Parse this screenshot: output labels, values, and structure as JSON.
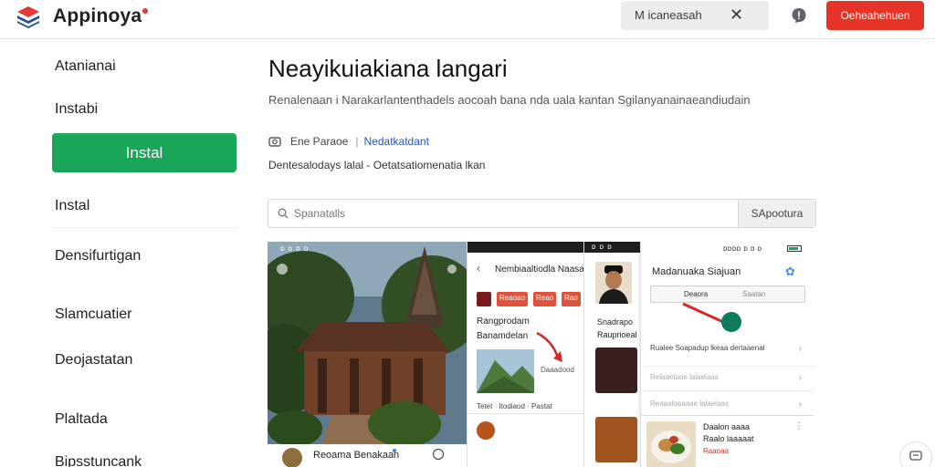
{
  "header": {
    "brand": "Appinoya",
    "search_chip": "M icaneasah",
    "close_glyph": "✕",
    "action_button": "Oeheahehuen",
    "colors": {
      "accent": "#e53427",
      "install": "#1aa659"
    }
  },
  "sidebar": {
    "items": [
      {
        "label": "Atanianai"
      },
      {
        "label": "Instabi"
      },
      {
        "label": "Instal"
      },
      {
        "label": "Instal"
      },
      {
        "label": "Densifurtigan"
      },
      {
        "label": "Slamcuatier"
      },
      {
        "label": "Deojastatan"
      },
      {
        "label": "Plaltada"
      },
      {
        "label": "Bipsstuncank"
      }
    ]
  },
  "main": {
    "title": "Neayikuiakiana langari",
    "description": "Renalenaan i Narakarlantenthadels aocoah bana nda  uala kantan Sgilanyanainaeandiudain",
    "meta": {
      "label": "Ene Paraoe",
      "separator": "|",
      "link": "Nedatkatdant"
    },
    "sub_info": "Dentesalodays lalal - Oetatsatiomenatia lkan",
    "search": {
      "placeholder": "Spanatalls",
      "button": "SApootura"
    }
  },
  "screenshots": {
    "shot1": {
      "status": "ᴅ ᴅ ᴅ ᴅ",
      "caption": "Reoama Benakaan"
    },
    "shot2": {
      "title": "Nembiaaltiodla Naasaldio",
      "tags": [
        "Reaoao",
        "Reao",
        "Rao"
      ],
      "line1": "Rangprodam",
      "line2": "Banamdelan",
      "img_label": "Daaadood",
      "foot": "Tetet · Itodiaod · Pastat"
    },
    "shot3": {
      "status": "ᴅ ᴅ ᴅ",
      "text1": "Snadrapo",
      "text2": "Rauprioeal"
    },
    "shot4": {
      "status": "ᴅᴅᴅᴅ ᴅ ᴅ ᴅ",
      "title": "Madanuaka Siajuan",
      "tab1": "Deaora",
      "tab2": "Saatan",
      "row1": "Rualee Soapadup lkeaa dertaaenal",
      "row2": "Relaaetaoe lalaelaas",
      "row3": "Reaaaloaaaae lalaelaas",
      "card_t1": "Daalon aaaa",
      "card_t2": "Raalo laaaaat",
      "card_t3": "Raaoaa"
    }
  }
}
